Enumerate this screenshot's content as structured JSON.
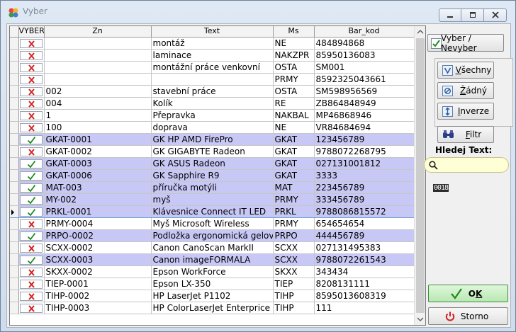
{
  "window": {
    "title": "Vyber"
  },
  "columns": [
    "VYBER",
    "Zn",
    "Text",
    "Ms",
    "Bar_kod"
  ],
  "rows": [
    {
      "checked": false,
      "zn": "",
      "text": "montáž",
      "ms": "NE",
      "bar": "484894868"
    },
    {
      "checked": false,
      "zn": "",
      "text": "laminace",
      "ms": "NAKZPR",
      "bar": "85950136083"
    },
    {
      "checked": false,
      "zn": "",
      "text": "montážní práce venkovní",
      "ms": "OSTA",
      "bar": "SM001"
    },
    {
      "checked": false,
      "zn": "",
      "text": "",
      "ms": "PRMY",
      "bar": "8592325043661"
    },
    {
      "checked": false,
      "zn": "002",
      "text": "stavební práce",
      "ms": "OSTA",
      "bar": "SM598956569"
    },
    {
      "checked": false,
      "zn": "004",
      "text": "Kolík",
      "ms": "RE",
      "bar": "ZB864848949"
    },
    {
      "checked": false,
      "zn": "1",
      "text": "Přepravka",
      "ms": "NAKBAL",
      "bar": "MP46868946"
    },
    {
      "checked": false,
      "zn": "100",
      "text": "doprava",
      "ms": "NE",
      "bar": "VR84684694"
    },
    {
      "checked": true,
      "zn": "GKAT-0001",
      "text": "GK HP AMD FirePro",
      "ms": "GKAT",
      "bar": "123456789"
    },
    {
      "checked": false,
      "zn": "GKAT-0002",
      "text": "GK  GIGABYTE Radeon",
      "ms": "GKAT",
      "bar": "9788072268795"
    },
    {
      "checked": true,
      "zn": "GKAT-0003",
      "text": "GK ASUS Radeon",
      "ms": "GKAT",
      "bar": "027131001812"
    },
    {
      "checked": true,
      "zn": "GKAT-0006",
      "text": "GK Sapphire R9",
      "ms": "GKAT",
      "bar": "3333"
    },
    {
      "checked": true,
      "zn": "MAT-003",
      "text": "příručka motýli",
      "ms": "MAT",
      "bar": "223456789"
    },
    {
      "checked": true,
      "zn": "MY-002",
      "text": "myš",
      "ms": "PRMY",
      "bar": "333456789"
    },
    {
      "checked": true,
      "zn": "PRKL-0001",
      "text": "Klávesnice Connect IT LED",
      "ms": "PRKL",
      "bar": "9788086815572",
      "current": true
    },
    {
      "checked": false,
      "zn": "PRMY-0004",
      "text": "Myš Microsoft Wireless",
      "ms": "PRMY",
      "bar": "654654654"
    },
    {
      "checked": true,
      "zn": "PRPO-0002",
      "text": "Podložka ergonomická gelová",
      "ms": "PRPO",
      "bar": "444456789"
    },
    {
      "checked": false,
      "zn": "SCXX-0002",
      "text": "Canon CanoScan MarkII",
      "ms": "SCXX",
      "bar": "027131495383"
    },
    {
      "checked": true,
      "zn": "SCXX-0003",
      "text": "Canon imageFORMALA",
      "ms": "SCXX",
      "bar": "9788072261543"
    },
    {
      "checked": false,
      "zn": "SKXX-0002",
      "text": "Epson WorkForce",
      "ms": "SKXX",
      "bar": "343434"
    },
    {
      "checked": false,
      "zn": "TIEP-0001",
      "text": "Epson LX-350",
      "ms": "TIEP",
      "bar": "8208131111"
    },
    {
      "checked": false,
      "zn": "TIHP-0002",
      "text": "HP LaserJet P1102",
      "ms": "TIHP",
      "bar": "8595013608319"
    },
    {
      "checked": false,
      "zn": "TIHP-0003",
      "text": "HP ColorLaserJet Enterprice",
      "ms": "TIHP",
      "bar": "111"
    }
  ],
  "side": {
    "vyber_nevyber": "Vyber / Nevyber",
    "vsechny": "Všechny",
    "zadny": "Žádný",
    "inverze": "Inverze",
    "filtr": "Filtr",
    "hledej_label": "Hledej Text:",
    "search_value": "",
    "counter": "0018",
    "ok": "OK",
    "storno": "Storno"
  },
  "colors": {
    "selected_row": "#c8c8f6",
    "ok_green": "#1e8a1e",
    "uncheck_red": "#d42020"
  }
}
